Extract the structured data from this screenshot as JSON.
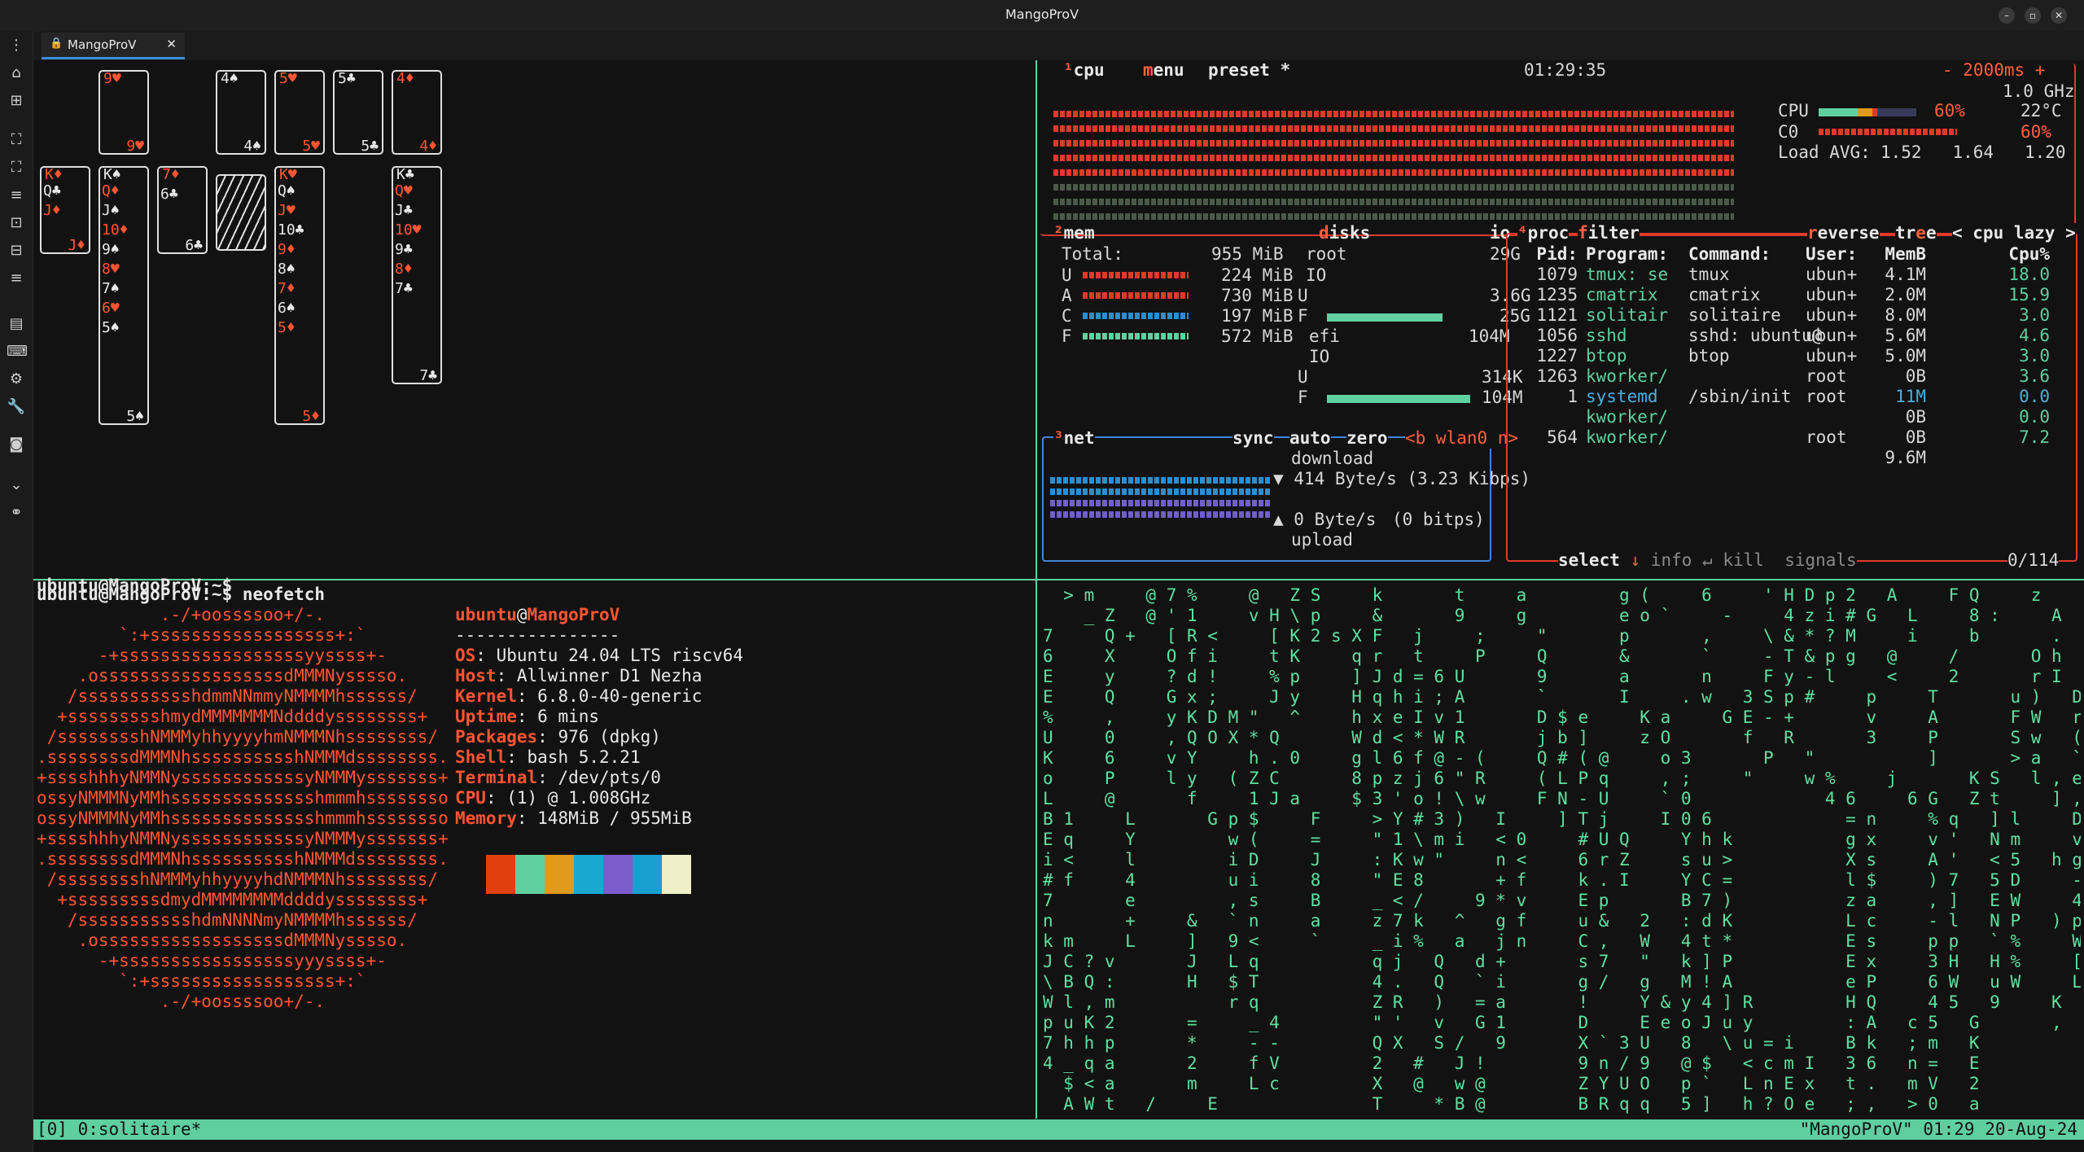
{
  "window": {
    "title": "MangoProV"
  },
  "tab": {
    "label": "MangoProV"
  },
  "toolbar": {
    "icons": [
      "menu-icon",
      "home-icon",
      "new-tab-icon",
      "fullscreen-icon",
      "expand-icon",
      "list-icon",
      "split-icon",
      "split-alt-icon",
      "list-alt-icon",
      "window-icon",
      "keyboard-icon",
      "settings-icon",
      "wrench-icon",
      "camera-icon",
      "chevron-down-icon",
      "link-icon"
    ]
  },
  "solitaire": {
    "foundation": [
      {
        "rank": "9",
        "suit": "♥",
        "color": "red"
      },
      {
        "rank": "4",
        "suit": "♠",
        "color": "white"
      },
      {
        "rank": "5",
        "suit": "♥",
        "color": "red"
      },
      {
        "rank": "5",
        "suit": "♣",
        "color": "white"
      },
      {
        "rank": "4",
        "suit": "♦",
        "color": "red"
      }
    ],
    "col1": [
      "K♦",
      "Q♣",
      "J♦"
    ],
    "col2": [
      "K♠",
      "Q♦",
      "J♠",
      "10♦",
      "9♠",
      "8♥",
      "7♠",
      "6♥",
      "5♠"
    ],
    "col3": [
      "7♦",
      "6♣"
    ],
    "col5": [
      "K♥",
      "Q♠",
      "J♥",
      "10♣",
      "9♦",
      "8♠",
      "7♦",
      "6♠",
      "5♦"
    ],
    "col6": [
      "K♣",
      "Q♥",
      "J♣",
      "10♥",
      "9♣",
      "8♦",
      "7♣"
    ]
  },
  "btop": {
    "cpu": {
      "title": "cpu",
      "menu": "menu",
      "preset": "preset *",
      "clock": "01:29:35",
      "interval": "- 2000ms +",
      "freq": "1.0 GHz",
      "label": "CPU",
      "pct": "60%",
      "temp": "22°C",
      "core_label": "C0",
      "core_pct": "60%",
      "load_label": "Load AVG:",
      "load": "1.52   1.64   1.20"
    },
    "mem": {
      "title": "mem",
      "total_label": "Total:",
      "total": "955 MiB",
      "rows": [
        {
          "k": "U",
          "v": "224 MiB"
        },
        {
          "k": "A",
          "v": "730 MiB"
        },
        {
          "k": "C",
          "v": "197 MiB"
        },
        {
          "k": "F",
          "v": "572 MiB"
        }
      ]
    },
    "disks": {
      "title": "disks",
      "io": "io",
      "root": "root",
      "root_size": "29G",
      "io_label": "IO",
      "u_label": "U",
      "u_val": "3.6G",
      "f_label": "F",
      "f_val": "25G",
      "efi": "efi",
      "efi_size": "104M",
      "efi_io": "IO",
      "efi_u": "314K",
      "efi_f": "104M"
    },
    "net": {
      "title": "net",
      "sync": "sync",
      "auto": "auto",
      "zero": "zero",
      "iface": "<b wlan0 n>",
      "download_label": "download",
      "download": "▼ 414 Byte/s (3.23 Kibps)",
      "upload": "▲ 0 Byte/s",
      "upload_bits": "(0 bitps)",
      "upload_label": "upload"
    },
    "proc": {
      "title": "proc",
      "filter": "filter",
      "reverse": "reverse",
      "tree": "tree",
      "sort": "< cpu lazy >",
      "headers": [
        "Pid:",
        "Program:",
        "Command:",
        "User:",
        "MemB",
        "Cpu%"
      ],
      "rows": [
        [
          "1079",
          "tmux: se",
          "tmux",
          "ubun+",
          "4.1M",
          "18.0"
        ],
        [
          "1235",
          "cmatrix",
          "cmatrix",
          "ubun+",
          "2.0M",
          "15.9"
        ],
        [
          "1121",
          "solitair",
          "solitaire",
          "ubun+",
          "8.0M",
          "3.0"
        ],
        [
          "1056",
          "sshd",
          "sshd: ubuntu@",
          "ubun+",
          "5.6M",
          "4.6"
        ],
        [
          "1227",
          "btop",
          "btop",
          "ubun+",
          "5.0M",
          "3.0"
        ],
        [
          "1263",
          "kworker/",
          "",
          "root",
          "0B",
          "3.6"
        ],
        [
          "1",
          "systemd",
          "/sbin/init",
          "root",
          "11M",
          "0.0"
        ],
        [
          "",
          "kworker/",
          "",
          "",
          "0B",
          "0.0"
        ],
        [
          "564",
          "kworker/",
          "",
          "root",
          "0B",
          "7.2"
        ],
        [
          "",
          "",
          "",
          "",
          "9.6M",
          ""
        ]
      ],
      "footer_select": "select",
      "footer_info": "info",
      "footer_kill": "kill",
      "footer_signals": "signals",
      "count": "0/114"
    }
  },
  "neofetch": {
    "prompt1": "ubuntu@MangoProV:~$ neofetch",
    "user": "ubuntu",
    "at": "@",
    "host": "MangoProV",
    "sep": "----------------",
    "info": [
      {
        "k": "OS",
        "v": "Ubuntu 24.04 LTS riscv64"
      },
      {
        "k": "Host",
        "v": "Allwinner D1 Nezha"
      },
      {
        "k": "Kernel",
        "v": "6.8.0-40-generic"
      },
      {
        "k": "Uptime",
        "v": "6 mins"
      },
      {
        "k": "Packages",
        "v": "976 (dpkg)"
      },
      {
        "k": "Shell",
        "v": "bash 5.2.21"
      },
      {
        "k": "Terminal",
        "v": "/dev/pts/0"
      },
      {
        "k": "CPU",
        "v": "(1) @ 1.008GHz"
      },
      {
        "k": "Memory",
        "v": "148MiB / 955MiB"
      }
    ],
    "colors": [
      "#e0400e",
      "#5fcf9f",
      "#e09a1c",
      "#1aa8d0",
      "#7a5ccc",
      "#1aa0d0",
      "#efefc8"
    ],
    "prompt2": "ubuntu@MangoProV:~$",
    "logo": [
      "            .-/+oossssoo+/-.",
      "        `:+ssssssssssssssssss+:`",
      "      -+ssssssssssssssssssyyssss+-",
      "    .ossssssssssssssssssdMMMNysssso.",
      "   /ssssssssssshdmmNNmmyNMMMMhssssss/",
      "  +ssssssssshmydMMMMMMMNddddyssssssss+",
      " /sssssssshNMMMyhhyyyyhmNMMMNhssssssss/",
      ".ssssssssdMMMNhsssssssssshNMMMdssssssss.",
      "+sssshhhyNMMNyssssssssssssyNMMMysssssss+",
      "ossyNMMMNyMMhsssssssssssssshmmmhssssssso",
      "ossyNMMMNyMMhsssssssssssssshmmmhssssssso",
      "+sssshhhyNMMNyssssssssssssyNMMMysssssss+",
      ".ssssssssdMMMNhsssssssssshNMMMdssssssss.",
      " /sssssssshNMMMyhhyyyyhdNMMMNhssssssss/",
      "  +sssssssssdmydMMMMMMMMddddyssssssss+",
      "   /ssssssssssshdmNNNNmyNMMMMhssssss/",
      "    .ossssssssssssssssssdMMMNysssso.",
      "      -+sssssssssssssssssyyyssss+-",
      "        `:+ssssssssssssssssss+:`",
      "            .-/+oossssoo+/-."
    ]
  },
  "matrix": {
    "lines": [
      " >m  @7%  @ ZS  k   t  a    g(  6  'HDp2 A  FQ  z   #FI",
      "  _Z @'1  vH\\p  &   9  g    eo`  -  4zi#G L  8:  A   , ss",
      "7  Q+ [R<  [K2sXF j  ;  \"   p   ,  \\&*?M  i  b   .  `: ,",
      "6  X  Ofi  tK  qr t  P  Q   &   `  -T&pg @  /   Oh IE  H",
      "E  y  ?d!  %p  ]Jd=6U   9   a   n  Fy-l  <  2   rI /j  b",
      "E  Q  Gx;  Jy  Hqhi;A   `   I  .w 3Sp#  p  T   u) D7  t",
      "%  ,  yKDM\" ^  hxeIv1   D$e  Ka  GE-+   v  A   FW r\"  :",
      "U  0  ,QOX*Q   Wd<*WR   jb]  zO   f R   3  P   Sw (k)%",
      "K  6  vY  h.0  gl6f@-(  Q#(@  o3   P \"     ]   >a `0m,",
      "o  P  ly (ZC   8pzj6\"R  (LPq  ,;  \"  w%  j   KS l,eO",
      "L  @   f  1Ja  $3'o!\\w  FN-U  `0      46  6G Zt  ],<0",
      "B1  L   Gp$  F  >Y#3) I  ]Tj  I06      =n  %q ]l  DD;A",
      "Eq  Y    w(  =  \"1\\mi <0  #UQ  Yhk     gx  v' Nm  v8(",
      "i<  l    iD  J  :Kw\"  n<  6rZ  su>     Xs  A' <5 hgYS",
      "#f  4    ui  8  \"E8   +f  k.I  YC=     l$  )7 5D  -)",
      "7   e    ,s  B  _</  9*v  Ep   B7)     za  ,] EW  4)",
      "n   +  & `n  a  z7k ^ gf  u& 2 :dK     Lc  -l NP )p (",
      "km  L  ] 9<  `  _i% a jn  C, W 4t*     Es  pp `%  W  t",
      "JC?v   J Lq     qj Q d+   s7 \" k]P     Ex  3H H%  [  :",
      "\\BQ:   H $T     4. Q `i   g/ g M!A     eP  6W uW  L  3",
      "Wl,m     rq     ZR ) =a   !  Y&y4]R    HQ  45 9  K  b 6",
      "puK2   =  _4    \"' v G1   D  EeoJuy    :A c5 G   ,  h",
      "7hhp   *  --    QX S/ 9   X`3U 8 \\u=i  Bk ;m K     y",
      "4_qa   2  fV    2 # J!    9n/9 @$ <cmI 36 n= E     -",
      " $<a   m  Lc    X @ w@    ZYUO p` LnEx t. mV 2     !",
      " AWt /  E       T  *B@    BRqq 5] h?Oe ;, >0 a     @"
    ]
  },
  "statusbar": {
    "left": "[0] 0:solitaire*",
    "right": "\"MangoProV\" 01:29 20-Aug-24"
  }
}
